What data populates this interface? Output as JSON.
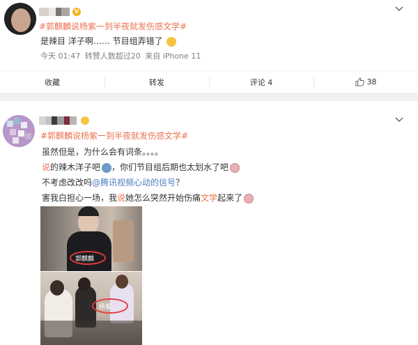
{
  "post1": {
    "username": "",
    "hashtag": "#郭麒麟说杨紫一到半夜就发伤感文学#",
    "text": "是辣目 洋子啊…… 节目组弄错了",
    "meta": {
      "time": "今天 01:47",
      "reposts": "转赞人数超过20",
      "source": "来自 iPhone 11"
    },
    "actions": {
      "favorite": "收藏",
      "repost": "转发",
      "comment": "评论 4",
      "like_count": "38"
    }
  },
  "post2": {
    "username": "",
    "hashtag": "#郭麒麟说杨紫一到半夜就发伤感文学#",
    "line1": "虽然但是，为什么会有词条。。。。",
    "line2_link": "说",
    "line2_text": "的辣木洋子吧",
    "line2_rest": "，你们节目组后期也太划水了吧",
    "line3_pre": "不考虑改改吗",
    "line3_mention": "@腾讯视频心动的信号",
    "line3_post": "？",
    "line4_pre": "害我白担心一场，我",
    "line4_link1": "说",
    "line4_mid": "她怎么突然开始伤痛",
    "line4_link2": "文学",
    "line4_post": "起来了",
    "caption1": "郭麒麟",
    "caption2": "杨紫"
  },
  "icons": [
    "chevron-down-icon",
    "thumbs-up-icon",
    "vip-badge-icon",
    "emoji-icon"
  ],
  "colors": {
    "link": "#eb7350",
    "mention": "#4b7bbf",
    "meta": "#808080",
    "vip": "#f5b31b"
  }
}
